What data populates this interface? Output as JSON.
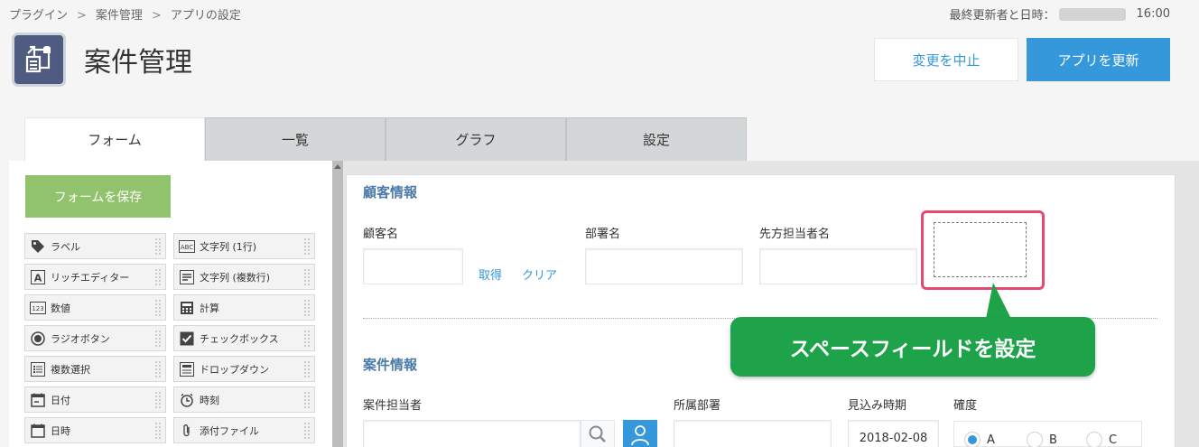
{
  "breadcrumb": {
    "items": [
      "プラグイン",
      "案件管理",
      "アプリの設定"
    ],
    "separator": ">"
  },
  "header": {
    "updater_label": "最終更新者と日時：",
    "updated_time": "16:00",
    "app_title": "案件管理",
    "cancel_label": "変更を中止",
    "update_label": "アプリを更新"
  },
  "tabs": [
    {
      "label": "フォーム",
      "active": true
    },
    {
      "label": "一覧"
    },
    {
      "label": "グラフ"
    },
    {
      "label": "設定"
    }
  ],
  "palette": {
    "save_label": "フォームを保存",
    "items": [
      {
        "label": "ラベル",
        "icon": "tag-icon"
      },
      {
        "label": "文字列 (1行)",
        "icon": "abc-icon"
      },
      {
        "label": "リッチエディター",
        "icon": "rich-text-icon"
      },
      {
        "label": "文字列 (複数行)",
        "icon": "multiline-icon"
      },
      {
        "label": "数値",
        "icon": "number-icon"
      },
      {
        "label": "計算",
        "icon": "calculator-icon"
      },
      {
        "label": "ラジオボタン",
        "icon": "radio-icon"
      },
      {
        "label": "チェックボックス",
        "icon": "checkbox-icon"
      },
      {
        "label": "複数選択",
        "icon": "multi-select-icon"
      },
      {
        "label": "ドロップダウン",
        "icon": "dropdown-icon"
      },
      {
        "label": "日付",
        "icon": "calendar-icon"
      },
      {
        "label": "時刻",
        "icon": "clock-icon"
      },
      {
        "label": "日時",
        "icon": "datetime-icon"
      },
      {
        "label": "添付ファイル",
        "icon": "paperclip-icon"
      }
    ]
  },
  "form": {
    "section1_title": "顧客情報",
    "customer_name_label": "顧客名",
    "get_link": "取得",
    "clear_link": "クリア",
    "department_label": "部署名",
    "contact_label": "先方担当者名",
    "section2_title": "案件情報",
    "owner_label": "案件担当者",
    "owner_department_label": "所属部署",
    "expected_date_label": "見込み時期",
    "expected_date_value": "2018-02-08",
    "certainty_label": "確度",
    "certainty_options": [
      "A",
      "B",
      "C"
    ],
    "certainty_selected": "A"
  },
  "annotation": {
    "callout_text": "スペースフィールドを設定"
  },
  "colors": {
    "accent": "#3498db",
    "save_green": "#91c36c",
    "callout_green": "#1fa34a",
    "highlight_red": "#e8486e"
  }
}
